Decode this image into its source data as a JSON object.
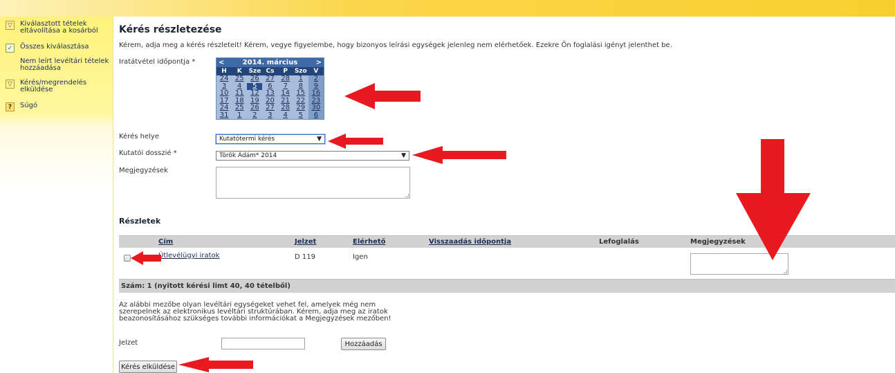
{
  "sidebar": {
    "items": [
      {
        "label": "Kiválasztott tételek eltávolítása a kosárból",
        "icon": "basket-icon"
      },
      {
        "label": "Összes kiválasztása",
        "icon": "checkbox-icon"
      },
      {
        "label": "Nem leírt levéltári tételek hozzáadása",
        "icon": ""
      },
      {
        "label": "Kérés/megrendelés elküldése",
        "icon": "basket-icon"
      },
      {
        "label": "Súgó",
        "icon": "help-icon"
      }
    ]
  },
  "page": {
    "title": "Kérés részletezése",
    "intro": "Kérem, adja meg a kérés részleteit! Kérem, vegye figyelembe, hogy bizonyos leírási egységek jelenleg nem elérhetőek. Ezekre Ön foglalási igényt jelenthet be."
  },
  "form": {
    "date_label": "Iratátvétel időpontja *",
    "location_label": "Kérés helye",
    "location_value": "Kutatótermi kérés",
    "dossier_label": "Kutatói dosszié *",
    "dossier_value": "Török Ádám* 2014",
    "notes_label": "Megjegyzések"
  },
  "calendar": {
    "prev": "<",
    "next": ">",
    "month": "2014. március",
    "weekdays": [
      "H",
      "K",
      "Sze",
      "Cs",
      "P",
      "Szo",
      "V"
    ],
    "weeks": [
      [
        "24",
        "25",
        "26",
        "27",
        "28",
        "1",
        "2"
      ],
      [
        "3",
        "4",
        "5",
        "6",
        "7",
        "8",
        "9"
      ],
      [
        "10",
        "11",
        "12",
        "13",
        "14",
        "15",
        "16"
      ],
      [
        "17",
        "18",
        "19",
        "20",
        "21",
        "22",
        "23"
      ],
      [
        "24",
        "25",
        "26",
        "27",
        "28",
        "29",
        "30"
      ],
      [
        "31",
        "1",
        "2",
        "3",
        "4",
        "5",
        "6"
      ]
    ],
    "selected": "5"
  },
  "details": {
    "title": "Részletek",
    "columns": [
      "Cím",
      "Jelzet",
      "Elérhető",
      "Visszaadás időpontja",
      "Lefoglalás",
      "Megjegyzések"
    ],
    "rows": [
      {
        "cim": "Útlevélügyi iratok",
        "jelzet": "D 119",
        "elerheto": "Igen"
      }
    ],
    "footer": "Szám: 1 (nyitott kérési limt 40, 40 tételből)"
  },
  "add_section": {
    "description": "Az alábbi mezőbe olyan levéltári egységeket vehet fel, amelyek még nem szerepelnek az elektronikus levéltári struktúrában. Kérem, adja meg az iratok beazonosításához szükséges további információkat a Megjegyzések mezőben!",
    "jelzet_label": "Jelzet",
    "add_button": "Hozzáadás",
    "submit_button": "Kérés elküldése"
  },
  "colors": {
    "arrow": "#e8191f",
    "calendar_header": "#3e6aa7",
    "sidebar": "#fff27a"
  }
}
